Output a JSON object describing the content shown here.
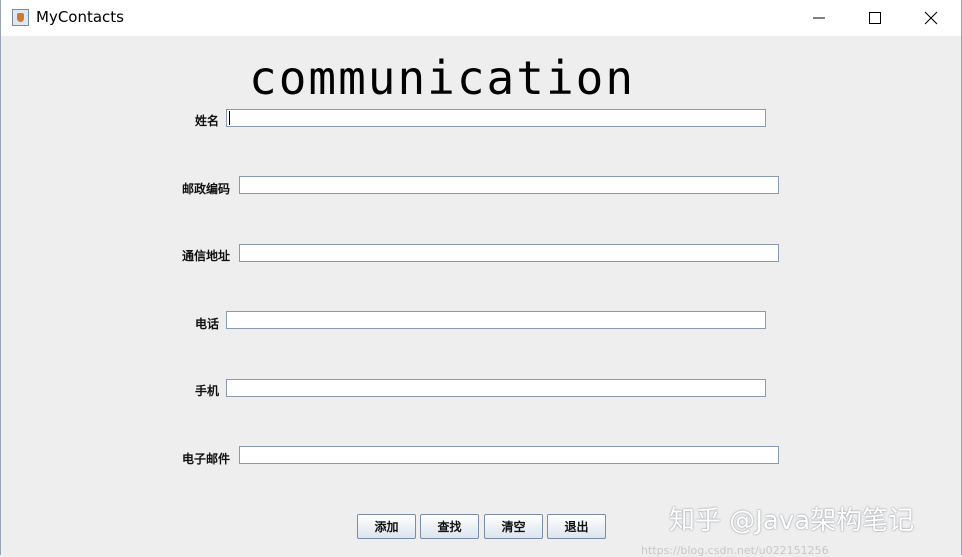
{
  "window": {
    "title": "MyContacts"
  },
  "banner": {
    "text": "communication"
  },
  "form": {
    "fields": [
      {
        "label": "姓名",
        "value": ""
      },
      {
        "label": "邮政编码",
        "value": ""
      },
      {
        "label": "通信地址",
        "value": ""
      },
      {
        "label": "电话",
        "value": ""
      },
      {
        "label": "手机",
        "value": ""
      },
      {
        "label": "电子邮件",
        "value": ""
      }
    ]
  },
  "buttons": {
    "add": "添加",
    "find": "查找",
    "clear": "清空",
    "exit": "退出"
  },
  "watermark": {
    "text": "知乎 @Java架构笔记",
    "url": "https://blog.csdn.net/u022151256"
  }
}
